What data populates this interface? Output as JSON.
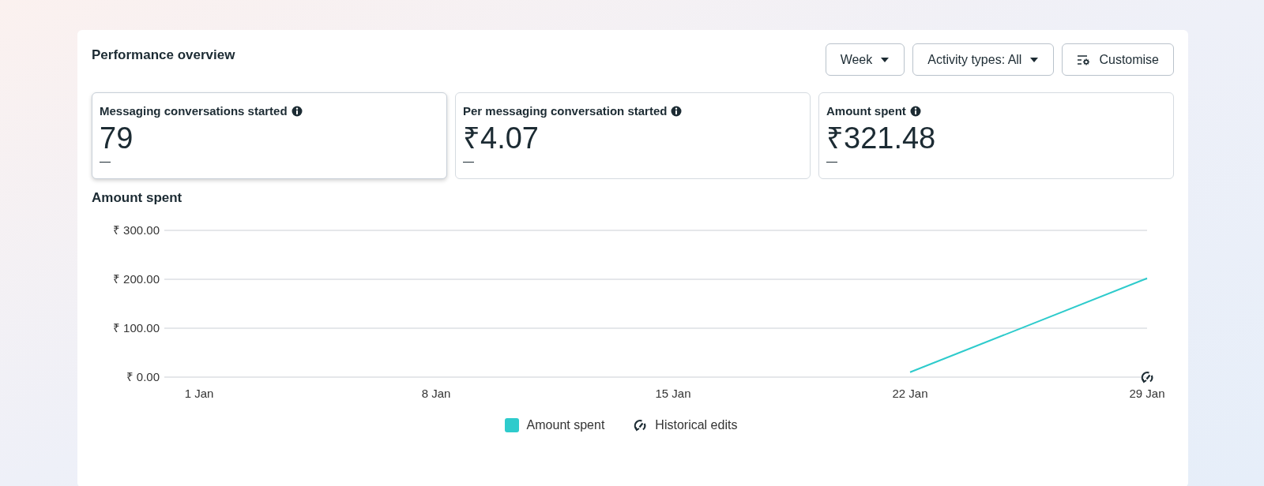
{
  "panel": {
    "title": "Performance overview",
    "controls": [
      {
        "kind": "dropdown",
        "label": "Week"
      },
      {
        "kind": "dropdown",
        "label": "Activity types: All"
      },
      {
        "kind": "customise",
        "label": "Customise"
      }
    ],
    "metrics": [
      {
        "label": "Messaging conversations started",
        "value": "79",
        "change": "—",
        "selected": true
      },
      {
        "label": "Per messaging conversation started",
        "value": "₹4.07",
        "change": "—",
        "selected": false
      },
      {
        "label": "Amount spent",
        "value": "₹321.48",
        "change": "—",
        "selected": false
      }
    ],
    "chart_title": "Amount spent",
    "chart_data": {
      "type": "line",
      "categories": [
        "1 Jan",
        "8 Jan",
        "15 Jan",
        "22 Jan",
        "29 Jan"
      ],
      "series": [
        {
          "name": "Amount spent",
          "color": "#2ecbcc",
          "values": [
            null,
            null,
            null,
            10,
            202
          ]
        }
      ],
      "ylim": [
        0,
        300
      ],
      "yticks": [
        {
          "value": 0,
          "label": "₹ 0.00"
        },
        {
          "value": 100,
          "label": "₹ 100.00"
        },
        {
          "value": 200,
          "label": "₹ 200.00"
        },
        {
          "value": 300,
          "label": "₹ 300.00"
        }
      ],
      "annotations": [
        {
          "x": "29 Jan"
        }
      ]
    },
    "legend": [
      {
        "kind": "edits",
        "label": "Historical edits"
      }
    ]
  }
}
